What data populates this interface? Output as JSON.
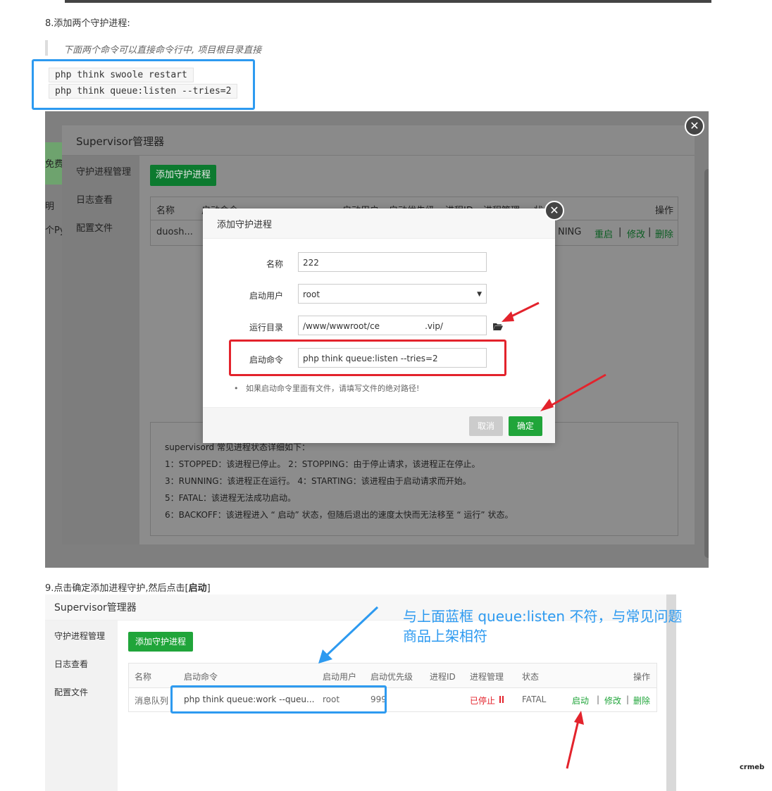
{
  "doc": {
    "step8": "8.添加两个守护进程:",
    "quote": "下面两个命令可以直接命令行中, 项目根目录直接",
    "commands": [
      "php think swoole restart",
      "php think queue:listen --tries=2"
    ],
    "step9_prefix": "9.点击确定添加进程守护,然后点击[",
    "step9_bold": "启动",
    "step9_suffix": "]",
    "annotation_line1": "与上面蓝框 queue:listen 不符，与常见问题",
    "annotation_line2": "商品上架相符",
    "watermark": "crmeb"
  },
  "shot1": {
    "bg_left_labels": [
      "免费",
      "明",
      "个Py"
    ],
    "panel_title": "Supervisor管理器",
    "side_items": [
      "守护进程管理",
      "日志查看",
      "配置文件"
    ],
    "add_button": "添加守护进程",
    "table_header_name": "名称",
    "table_header_cmd": "启动命令",
    "table_header_user": "启动用户",
    "table_header_prio": "启动优先级",
    "table_header_pid": "进程ID",
    "table_header_mgmt": "进程管理",
    "table_header_state": "状",
    "table_header_ops": "操作",
    "row_name": "duosh...",
    "row_state": "NING",
    "row_ops": [
      "重启",
      "修改",
      "删除"
    ],
    "info_lines": [
      "supervisord 常见进程状态详细如下：",
      "1：STOPPED：该进程已停止。     2：STOPPING：由于停止请求，该进程正在停止。",
      "3：RUNNING：该进程正在运行。 4：STARTING：该进程由于启动请求而开始。",
      "5：FATAL：该进程无法成功启动。",
      "6：BACKOFF：该进程进入 “ 启动” 状态，但随后退出的速度太快而无法移至 “ 运行” 状态。"
    ]
  },
  "modal": {
    "title": "添加守护进程",
    "name_label": "名称",
    "name_value": "222",
    "user_label": "启动用户",
    "user_value": "root",
    "dir_label": "运行目录",
    "dir_value_start": "/www/wwwroot/ce",
    "dir_value_end": ".vip/",
    "cmd_label": "启动命令",
    "cmd_value": "php think queue:listen --tries=2",
    "hint": "如果启动命令里面有文件，请填写文件的绝对路径!",
    "cancel": "取消",
    "ok": "确定"
  },
  "shot2": {
    "title": "Supervisor管理器",
    "side_items": [
      "守护进程管理",
      "日志查看",
      "配置文件"
    ],
    "add_button": "添加守护进程",
    "headers": [
      "名称",
      "启动命令",
      "启动用户",
      "启动优先级",
      "进程ID",
      "进程管理",
      "状态",
      "操作"
    ],
    "row": {
      "name": "消息队列",
      "cmd": "php think queue:work --queu...",
      "user": "root",
      "prio": "999",
      "mgmt": "已停止",
      "state": "FATAL",
      "ops": [
        "启动",
        "修改",
        "删除"
      ]
    }
  }
}
